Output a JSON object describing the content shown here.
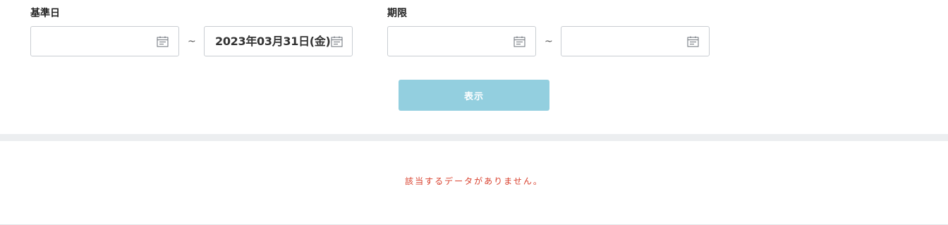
{
  "filters": {
    "base_date": {
      "label": "基準日",
      "from_value": "",
      "separator": "~",
      "to_value": "2023年03月31日(金)"
    },
    "deadline": {
      "label": "期限",
      "from_value": "",
      "separator": "~",
      "to_value": ""
    }
  },
  "actions": {
    "show_label": "表示",
    "show_button_color": "#93cfdf"
  },
  "results": {
    "empty_message": "該当するデータがありません。",
    "empty_message_color": "#d9412e"
  },
  "icons": {
    "date_picker": "calendar-icon"
  }
}
